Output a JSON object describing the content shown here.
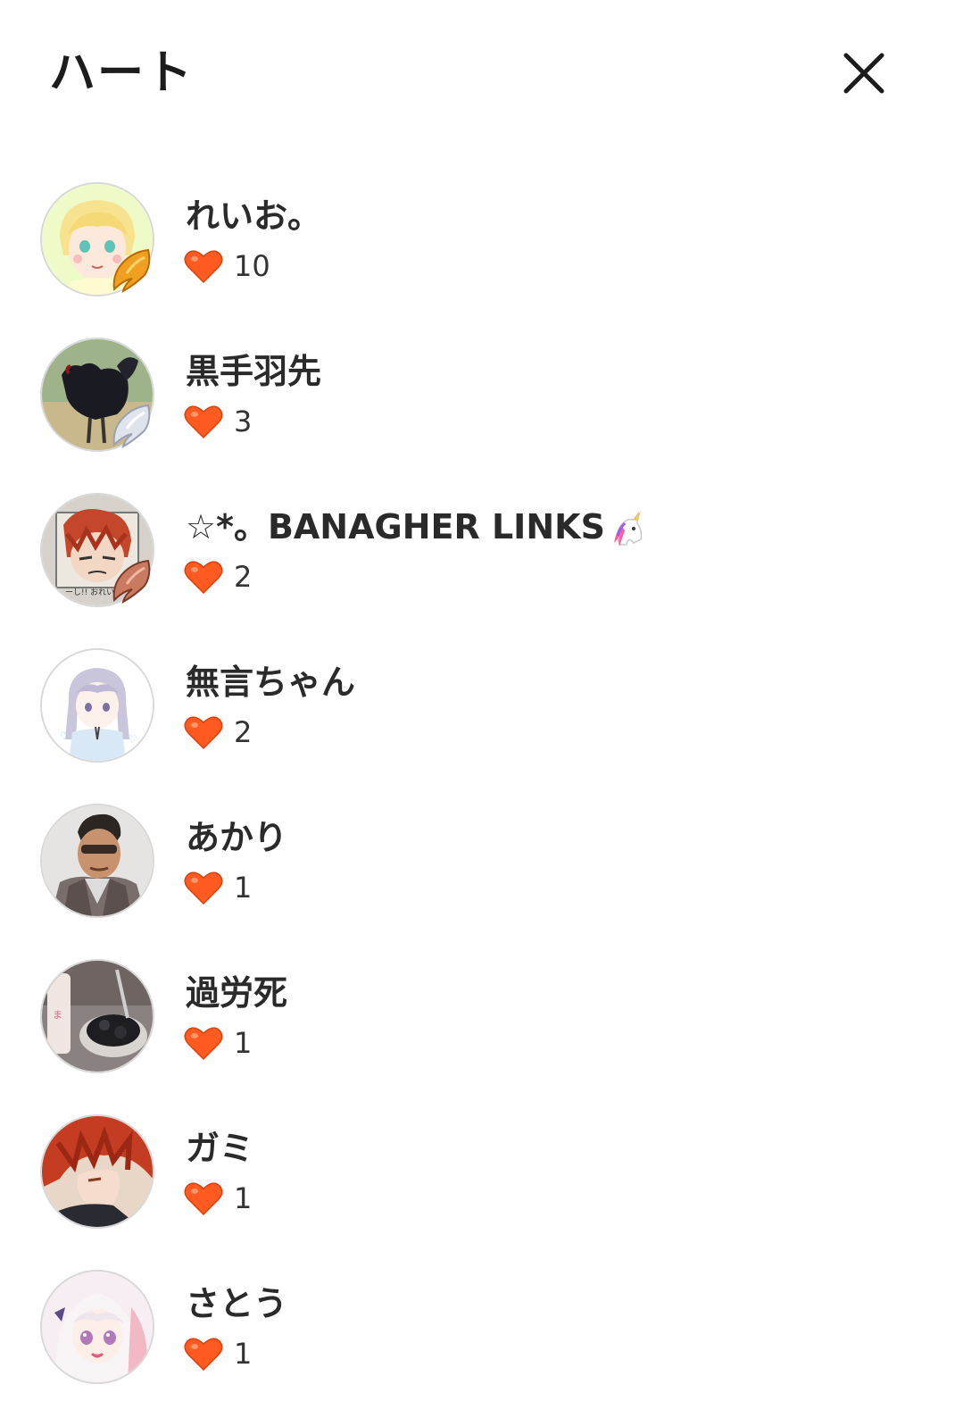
{
  "header": {
    "title": "ハート",
    "close_icon": "close-icon"
  },
  "colors": {
    "heart": "#ff5a1f",
    "heart_dark": "#e0400f",
    "avatar_border": "#d8d8d8",
    "text": "#2a2a2a"
  },
  "users": [
    {
      "name": "れいお。",
      "count": "10",
      "avatar": "anime-blond-boy-avatar",
      "badge": "gold-wing-badge"
    },
    {
      "name": "黒手羽先",
      "count": "3",
      "avatar": "black-rooster-avatar",
      "badge": "silver-wing-badge"
    },
    {
      "name": "☆*。BANAGHER LINKS",
      "count": "2",
      "avatar": "red-hair-drawing-avatar",
      "badge": "bronze-wing-badge",
      "emoji": "unicorn-icon"
    },
    {
      "name": "無言ちゃん",
      "count": "2",
      "avatar": "lavender-girl-avatar"
    },
    {
      "name": "あかり",
      "count": "1",
      "avatar": "sunglasses-man-avatar"
    },
    {
      "name": "過労死",
      "count": "1",
      "avatar": "food-photo-avatar"
    },
    {
      "name": "ガミ",
      "count": "1",
      "avatar": "red-hair-boy-avatar"
    },
    {
      "name": "さとう",
      "count": "1",
      "avatar": "white-hair-girl-avatar"
    }
  ]
}
